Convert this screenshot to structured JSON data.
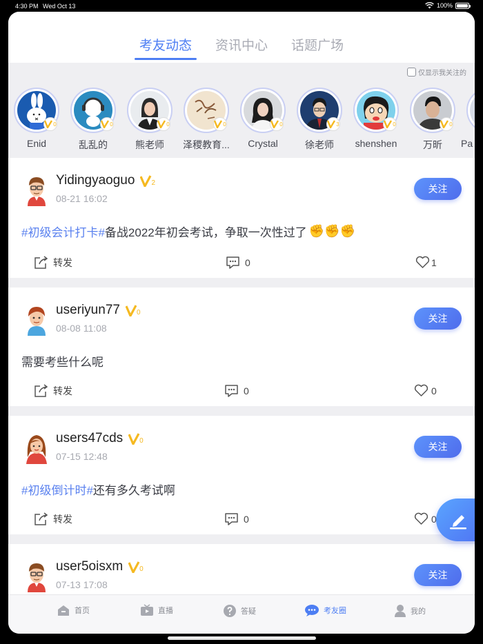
{
  "status_bar": {
    "time": "4:30 PM",
    "date": "Wed Oct 13",
    "battery": "100%"
  },
  "tabs": [
    {
      "label": "考友动态",
      "active": true
    },
    {
      "label": "资讯中心",
      "active": false
    },
    {
      "label": "话题广场",
      "active": false
    }
  ],
  "filter": {
    "label": "仅显示我关注的",
    "checked": false
  },
  "avatars": [
    {
      "name": "Enid",
      "level": "0"
    },
    {
      "name": "乱乱的",
      "level": "0"
    },
    {
      "name": "熊老师",
      "level": "0"
    },
    {
      "name": "泽稷教育...",
      "level": "0"
    },
    {
      "name": "Crystal",
      "level": "0"
    },
    {
      "name": "徐老师",
      "level": "3"
    },
    {
      "name": "shenshen",
      "level": "0"
    },
    {
      "name": "万昕",
      "level": "0"
    },
    {
      "name": "Pa",
      "level": "0"
    }
  ],
  "posts": [
    {
      "username": "Yidingyaoguo",
      "level": "2",
      "time": "08-21 16:02",
      "hashtag": "#初级会计打卡#",
      "text": "备战2022年初会考试，争取一次性过了",
      "emoji": "✊✊✊",
      "follow": "关注",
      "repost": "转发",
      "comments": "0",
      "likes": "1"
    },
    {
      "username": "useriyun77",
      "level": "0",
      "time": "08-08 11:08",
      "hashtag": "",
      "text": "需要考些什么呢",
      "emoji": "",
      "follow": "关注",
      "repost": "转发",
      "comments": "0",
      "likes": "0"
    },
    {
      "username": "users47cds",
      "level": "0",
      "time": "07-15 12:48",
      "hashtag": "#初级倒计时#",
      "text": "还有多久考试啊",
      "emoji": "",
      "follow": "关注",
      "repost": "转发",
      "comments": "0",
      "likes": "0"
    },
    {
      "username": "user5oisxm",
      "level": "0",
      "time": "07-13 17:08",
      "hashtag": "",
      "text": "",
      "emoji": "",
      "follow": "关注",
      "repost": "转发",
      "comments": "0",
      "likes": "0"
    }
  ],
  "tabbar": [
    {
      "label": "首页",
      "icon": "home-icon",
      "active": false
    },
    {
      "label": "直播",
      "icon": "live-icon",
      "active": false
    },
    {
      "label": "答疑",
      "icon": "question-icon",
      "active": false
    },
    {
      "label": "考友圈",
      "icon": "chat-icon",
      "active": true
    },
    {
      "label": "我的",
      "icon": "user-icon",
      "active": false
    }
  ],
  "colors": {
    "accent": "#4d7ef3",
    "hashtag": "#5b82ef",
    "badge": "#f5b921"
  }
}
